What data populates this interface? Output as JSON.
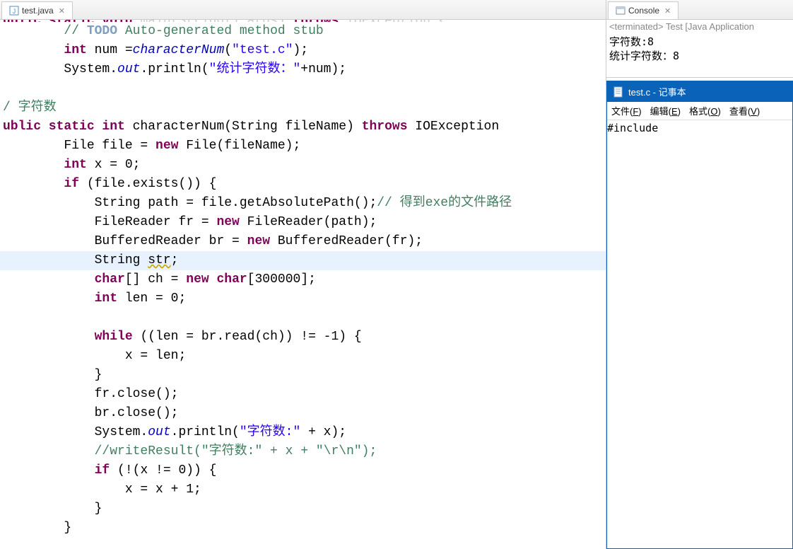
{
  "editor": {
    "tab_label": "test.java",
    "code_lines": [
      {
        "indent": 0,
        "segs": [
          {
            "t": "ublic static void",
            "c": "kw partial"
          },
          {
            "t": " main(String[] args) "
          },
          {
            "t": "throws",
            "c": "kw"
          },
          {
            "t": " IOException {"
          }
        ],
        "faded": true
      },
      {
        "indent": 2,
        "segs": [
          {
            "t": "// ",
            "c": "cm"
          },
          {
            "t": "TODO",
            "c": "todo"
          },
          {
            "t": " Auto-generated method stub",
            "c": "cm"
          }
        ]
      },
      {
        "indent": 2,
        "segs": [
          {
            "t": "int",
            "c": "kw"
          },
          {
            "t": " num ="
          },
          {
            "t": "characterNum",
            "c": "fld"
          },
          {
            "t": "("
          },
          {
            "t": "\"test.c\"",
            "c": "str"
          },
          {
            "t": ");"
          }
        ]
      },
      {
        "indent": 2,
        "segs": [
          {
            "t": "System."
          },
          {
            "t": "out",
            "c": "fld"
          },
          {
            "t": ".println("
          },
          {
            "t": "\"统计字符数：\"",
            "c": "str"
          },
          {
            "t": "+num);"
          }
        ]
      },
      {
        "indent": 1,
        "segs": []
      },
      {
        "indent": 0,
        "segs": [
          {
            "t": "/ ",
            "c": "cm"
          },
          {
            "t": "字符数",
            "c": "cm"
          }
        ]
      },
      {
        "indent": 0,
        "segs": [
          {
            "t": "ublic static int",
            "c": "kw"
          },
          {
            "t": " characterNum(String fileName) "
          },
          {
            "t": "throws",
            "c": "kw"
          },
          {
            "t": " IOException"
          }
        ]
      },
      {
        "indent": 2,
        "segs": [
          {
            "t": "File file = "
          },
          {
            "t": "new",
            "c": "kw"
          },
          {
            "t": " File(fileName);"
          }
        ]
      },
      {
        "indent": 2,
        "segs": [
          {
            "t": "int",
            "c": "kw"
          },
          {
            "t": " x = 0;"
          }
        ]
      },
      {
        "indent": 2,
        "segs": [
          {
            "t": "if",
            "c": "kw"
          },
          {
            "t": " (file.exists()) {"
          }
        ]
      },
      {
        "indent": 3,
        "segs": [
          {
            "t": "String path = file.getAbsolutePath();"
          },
          {
            "t": "// 得到exe的文件路径",
            "c": "cm"
          }
        ]
      },
      {
        "indent": 3,
        "segs": [
          {
            "t": "FileReader fr = "
          },
          {
            "t": "new",
            "c": "kw"
          },
          {
            "t": " FileReader(path);"
          }
        ]
      },
      {
        "indent": 3,
        "segs": [
          {
            "t": "BufferedReader br = "
          },
          {
            "t": "new",
            "c": "kw"
          },
          {
            "t": " BufferedReader(fr);"
          }
        ]
      },
      {
        "indent": 3,
        "segs": [
          {
            "t": "String "
          },
          {
            "t": "str",
            "c": "warn"
          },
          {
            "t": ";"
          }
        ],
        "highlight": true
      },
      {
        "indent": 3,
        "segs": [
          {
            "t": "char",
            "c": "kw"
          },
          {
            "t": "[] ch = "
          },
          {
            "t": "new",
            "c": "kw"
          },
          {
            "t": " "
          },
          {
            "t": "char",
            "c": "kw"
          },
          {
            "t": "[300000];"
          }
        ]
      },
      {
        "indent": 3,
        "segs": [
          {
            "t": "int",
            "c": "kw"
          },
          {
            "t": " len = 0;"
          }
        ]
      },
      {
        "indent": 3,
        "segs": []
      },
      {
        "indent": 3,
        "segs": [
          {
            "t": "while",
            "c": "kw"
          },
          {
            "t": " ((len = br.read(ch)) != -1) {"
          }
        ]
      },
      {
        "indent": 4,
        "segs": [
          {
            "t": "x = len;"
          }
        ]
      },
      {
        "indent": 3,
        "segs": [
          {
            "t": "}"
          }
        ]
      },
      {
        "indent": 3,
        "segs": [
          {
            "t": "fr.close();"
          }
        ]
      },
      {
        "indent": 3,
        "segs": [
          {
            "t": "br.close();"
          }
        ]
      },
      {
        "indent": 3,
        "segs": [
          {
            "t": "System."
          },
          {
            "t": "out",
            "c": "fld"
          },
          {
            "t": ".println("
          },
          {
            "t": "\"字符数:\"",
            "c": "str"
          },
          {
            "t": " + x);"
          }
        ]
      },
      {
        "indent": 3,
        "segs": [
          {
            "t": "//writeResult(\"字符数:\" + x + \"\\r\\n\");",
            "c": "cm"
          }
        ]
      },
      {
        "indent": 3,
        "segs": [
          {
            "t": "if",
            "c": "kw"
          },
          {
            "t": " (!(x != 0)) {"
          }
        ]
      },
      {
        "indent": 4,
        "segs": [
          {
            "t": "x = x + 1;"
          }
        ]
      },
      {
        "indent": 3,
        "segs": [
          {
            "t": "}"
          }
        ]
      },
      {
        "indent": 2,
        "segs": [
          {
            "t": "}"
          }
        ]
      }
    ]
  },
  "console": {
    "tab_label": "Console",
    "status": "<terminated> Test [Java Application",
    "output_lines": [
      "字符数:8",
      "统计字符数：8"
    ]
  },
  "notepad": {
    "title": "test.c - 记事本",
    "menu": {
      "file": "文件(F)",
      "edit": "编辑(E)",
      "format": "格式(O)",
      "view": "查看(V)"
    },
    "content": "#include"
  }
}
